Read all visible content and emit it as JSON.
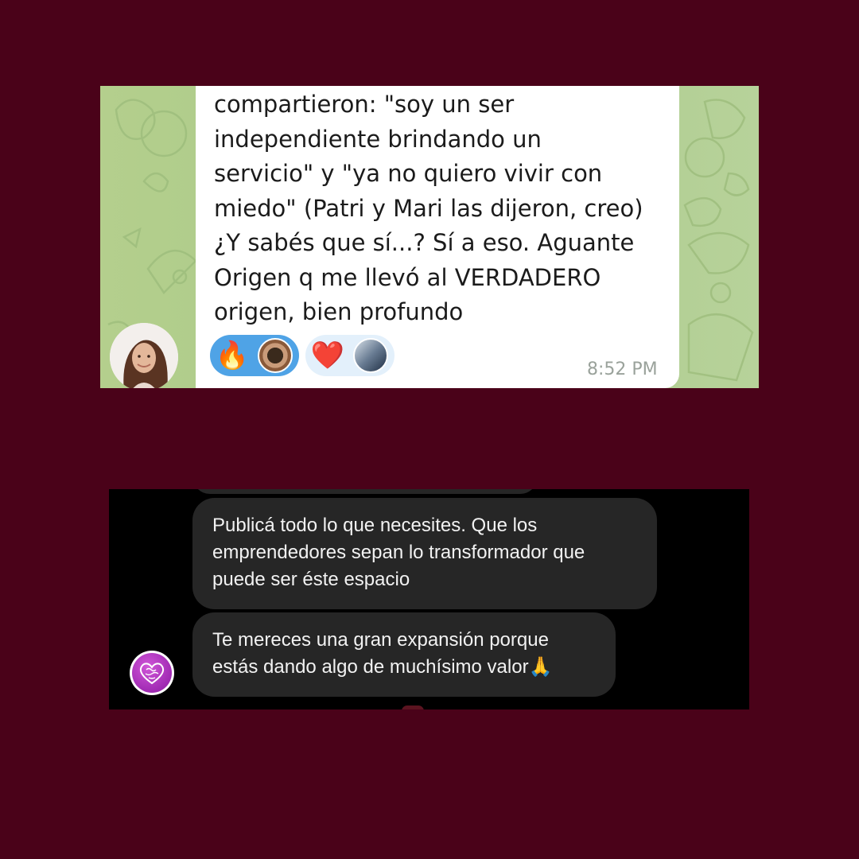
{
  "colors": {
    "page_background": "#4a0219",
    "telegram_bg": "#afcc8c",
    "dark_bg": "#000000",
    "dark_bubble": "#262626",
    "own_reaction": "#4fa3e6"
  },
  "screenshot_1": {
    "message_text": "compartieron: \"soy un ser\nindependiente brindando un\nservicio\" y \"ya no quiero vivir con\nmiedo\" (Patri y Mari las dijeron, creo)\n¿Y sabés que sí...? Sí a eso. Aguante\nOrigen q me llevó al VERDADERO\norigen, bien profundo",
    "reactions": [
      {
        "emoji": "🔥",
        "icon": "fire-emoji",
        "own": true
      },
      {
        "emoji": "❤️",
        "icon": "red-heart-emoji",
        "own": false
      }
    ],
    "time": "8:52 PM",
    "sender_avatar": "woman-photo-avatar"
  },
  "screenshot_2": {
    "messages": [
      {
        "text": "Publicá todo lo que necesites. Que los\nemprendedores sepan lo transformador que\npuede ser éste espacio"
      },
      {
        "text": "Te mereces una gran expansión porque\nestás dando algo de muchísimo valor🙏"
      }
    ],
    "sender_avatar": "heart-brain-logo-avatar"
  }
}
